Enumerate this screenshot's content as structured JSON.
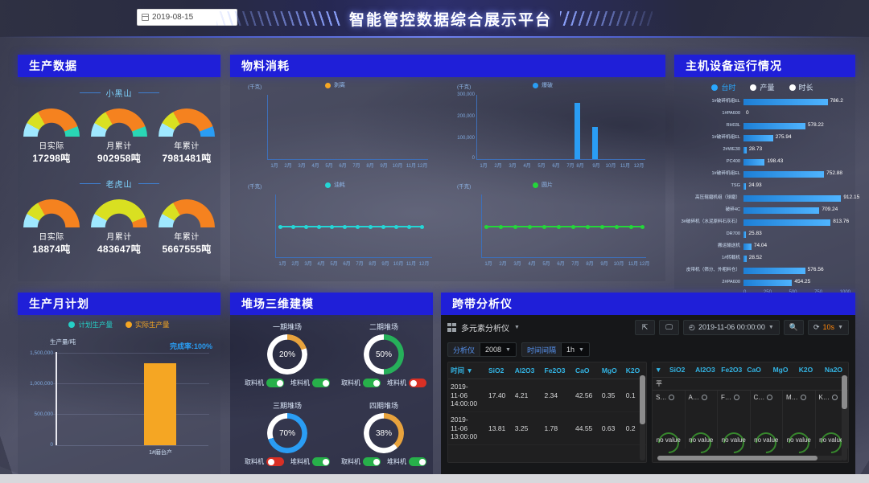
{
  "header": {
    "date_value": "2019-08-15",
    "calendar_icon": "calendar-icon",
    "title": "智能管控数据综合展示平台"
  },
  "panels": {
    "production": {
      "title": "生产数据",
      "groups": [
        {
          "name": "小黑山",
          "gauges": [
            {
              "label": "日实际",
              "value": "17298吨"
            },
            {
              "label": "月累计",
              "value": "902958吨"
            },
            {
              "label": "年累计",
              "value": "7981481吨"
            }
          ]
        },
        {
          "name": "老虎山",
          "gauges": [
            {
              "label": "日实际",
              "value": "18874吨"
            },
            {
              "label": "月累计",
              "value": "483647吨"
            },
            {
              "label": "年累计",
              "value": "5667555吨"
            }
          ]
        }
      ]
    },
    "material": {
      "title": "物料消耗",
      "charts": [
        {
          "unit": "(千克)",
          "legend": "剥离",
          "legend_color": "#f5a623",
          "type": "bar",
          "categories": [
            "1月",
            "2月",
            "3月",
            "4月",
            "5月",
            "6月",
            "7月",
            "8月",
            "9月",
            "10月",
            "11月",
            "12月"
          ],
          "values": [
            0,
            0,
            0,
            0,
            0,
            0,
            0,
            0,
            0,
            0,
            0,
            0
          ]
        },
        {
          "unit": "(千克)",
          "legend": "爆破",
          "legend_color": "#2a9df4",
          "type": "bar",
          "categories": [
            "1月",
            "2月",
            "3月",
            "4月",
            "5月",
            "6月",
            "7月",
            "8月",
            "9月",
            "10月",
            "11月",
            "12月"
          ],
          "yticks": [
            "300,000",
            "200,000",
            "100,000",
            "0"
          ],
          "values": [
            0,
            0,
            0,
            0,
            0,
            0,
            0,
            248000,
            118000,
            0,
            0,
            0
          ]
        },
        {
          "unit": "(千克)",
          "legend": "油耗",
          "legend_color": "#24d6d6",
          "type": "line",
          "categories": [
            "1月",
            "2月",
            "3月",
            "4月",
            "5月",
            "6月",
            "7月",
            "8月",
            "9月",
            "10月",
            "11月",
            "12月"
          ],
          "values": [
            0,
            0,
            0,
            0,
            0,
            0,
            0,
            0,
            0,
            0,
            0,
            0
          ]
        },
        {
          "unit": "(千克)",
          "legend": "圆片",
          "legend_color": "#24d63a",
          "type": "line",
          "categories": [
            "1月",
            "2月",
            "3月",
            "4月",
            "5月",
            "6月",
            "7月",
            "8月",
            "9月",
            "10月",
            "11月",
            "12月"
          ],
          "values": [
            0,
            0,
            0,
            0,
            0,
            0,
            0,
            0,
            0,
            0,
            0,
            0
          ]
        }
      ]
    },
    "equipment": {
      "title": "主机设备运行情况",
      "legend": [
        {
          "label": "台时",
          "active": true
        },
        {
          "label": "产量",
          "active": false
        },
        {
          "label": "时长",
          "active": false
        }
      ],
      "chart_data": {
        "type": "bar",
        "orientation": "horizontal",
        "xlim": [
          0,
          1000
        ],
        "xticks": [
          "0",
          "250",
          "500",
          "750",
          "1000"
        ],
        "categories": [
          "1#破碎机组EL",
          "1#PA600",
          "RH03L",
          "1#破碎机组EL",
          "2#WE30",
          "PC400",
          "1#破碎机组EL",
          "TSG",
          "高压辊磨机组（球磨）",
          "破碎4C",
          "3#破碎机（水泥原料石灰石）",
          "DR700",
          "搬运输送机",
          "1#转载机",
          "皮带机（筛分、外粗料仓）",
          "2#PA600"
        ],
        "values": [
          786.2,
          0,
          578.22,
          275.94,
          28.73,
          198.43,
          752.88,
          24.93,
          912.15,
          709.24,
          813.76,
          25.83,
          74.04,
          28.52,
          576.56,
          454.25
        ],
        "value_labels": [
          "786.2",
          "0",
          "578.22",
          "275.94",
          "28.73",
          "198.43",
          "752.88",
          "24.93",
          "912.15",
          "709.24",
          "813.76",
          "25.83",
          "74.04",
          "28.52",
          "576.56",
          "454.25"
        ]
      }
    },
    "monthly_plan": {
      "title": "生产月计划",
      "legend": [
        {
          "label": "计划生产量",
          "color": "#25d0c8"
        },
        {
          "label": "实际生产量",
          "color": "#f5a623"
        }
      ],
      "rate_text": "完成率:100%",
      "chart_data": {
        "type": "bar",
        "ylabel": "生产量/吨",
        "yticks": [
          "1,500,000",
          "1,000,000",
          "500,000",
          "0"
        ],
        "ylim": [
          0,
          1500000
        ],
        "categories": [
          "1#磨台产"
        ],
        "values": [
          1260000
        ]
      }
    },
    "yard": {
      "title": "堆场三维建模",
      "items": [
        {
          "name": "一期堆场",
          "percent": "20%",
          "value": 20,
          "color": "#e8a33d",
          "reclaimer_label": "取料机",
          "reclaimer_on": true,
          "stacker_label": "堆料机",
          "stacker_on": true
        },
        {
          "name": "二期堆场",
          "percent": "50%",
          "value": 50,
          "color": "#26b05a",
          "reclaimer_label": "取料机",
          "reclaimer_on": true,
          "stacker_label": "堆料机",
          "stacker_on": false
        },
        {
          "name": "三期堆场",
          "percent": "70%",
          "value": 70,
          "color": "#2a9df4",
          "reclaimer_label": "取料机",
          "reclaimer_on": false,
          "stacker_label": "堆料机",
          "stacker_on": true
        },
        {
          "name": "四期堆场",
          "percent": "38%",
          "value": 38,
          "color": "#e8a33d",
          "reclaimer_label": "取料机",
          "reclaimer_on": true,
          "stacker_label": "堆料机",
          "stacker_on": true
        }
      ]
    },
    "analyzer": {
      "title": "跨带分析仪",
      "dashboard_name": "多元素分析仪",
      "toolbar": {
        "share_icon": "share-icon",
        "tv_icon": "tv-icon",
        "time_range": "2019-11-06 00:00:00 ",
        "clock_icon": "clock-icon",
        "zoom_icon": "search-icon",
        "refresh_icon": "refresh-icon",
        "refresh_interval": "10s"
      },
      "variables": [
        {
          "label": "分析仪",
          "value": "2008"
        },
        {
          "label": "时间间隔",
          "value": "1h"
        }
      ],
      "table": {
        "columns": [
          "时间",
          "SiO2",
          "Al2O3",
          "Fe2O3",
          "CaO",
          "MgO",
          "K2O"
        ],
        "rows": [
          [
            "2019-\n11-06\n14:00:00",
            "17.40",
            "4.21",
            "2.34",
            "42.56",
            "0.35",
            "0.1"
          ],
          [
            "2019-\n11-06\n13:00:00",
            "13.81",
            "3.25",
            "1.78",
            "44.55",
            "0.63",
            "0.2"
          ]
        ]
      },
      "gauge_table": {
        "columns": [
          "",
          "SiO2",
          "Al2O3",
          "Fe2O3",
          "CaO",
          "MgO",
          "K2O",
          "Na2O"
        ],
        "cells": [
          {
            "abbr": "S…",
            "value": "no value"
          },
          {
            "abbr": "A…",
            "value": "no value"
          },
          {
            "abbr": "F…",
            "value": "no value"
          },
          {
            "abbr": "C…",
            "value": "no value"
          },
          {
            "abbr": "M…",
            "value": "no value"
          },
          {
            "abbr": "K…",
            "value": "no value"
          }
        ]
      }
    }
  },
  "colors": {
    "panel_header": "#1f1fd8",
    "accent_blue": "#2a9df4",
    "accent_orange": "#f5a623",
    "gauge_orange": "#f5821f",
    "gauge_yellow": "#d9e021",
    "gauge_cyan": "#2ad6b5"
  }
}
